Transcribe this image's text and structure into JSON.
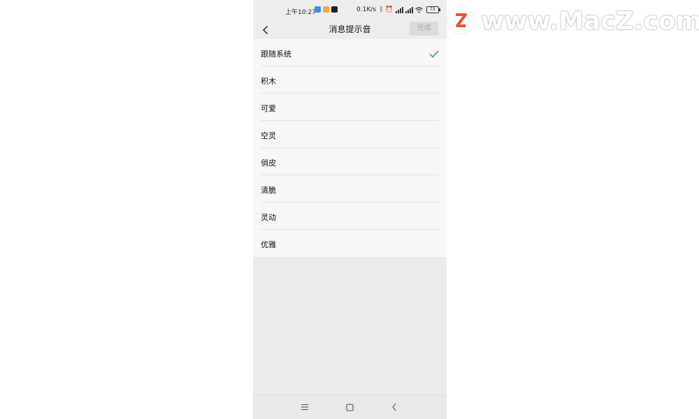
{
  "status_bar": {
    "time": "上午10:27",
    "net_speed": "0.1K/s",
    "battery": "73"
  },
  "header": {
    "title": "消息提示音",
    "done_label": "完成"
  },
  "sound_list": {
    "selected_index": 0,
    "items": [
      {
        "label": "跟随系统"
      },
      {
        "label": "积木"
      },
      {
        "label": "可爱"
      },
      {
        "label": "空灵"
      },
      {
        "label": "俏皮"
      },
      {
        "label": "清脆"
      },
      {
        "label": "灵动"
      },
      {
        "label": "优雅"
      }
    ]
  },
  "watermark": {
    "text": "www.MacZ.com"
  },
  "colors": {
    "check": "#2e9a5a",
    "logo": "#e8542a"
  }
}
